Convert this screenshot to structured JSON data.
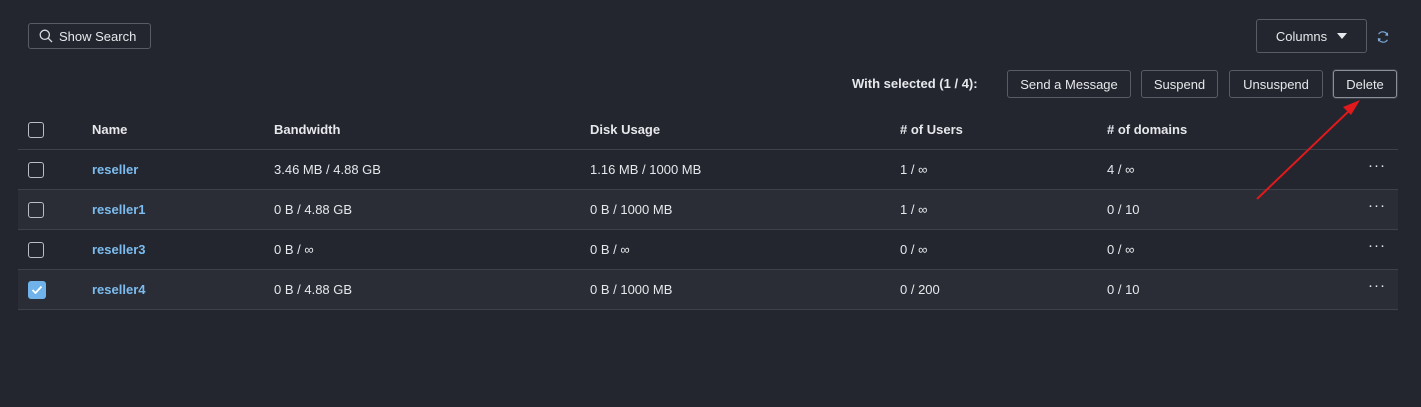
{
  "toolbar": {
    "show_search_label": "Show Search",
    "columns_label": "Columns",
    "with_selected_label": "With selected (1 / 4):",
    "send_message_label": "Send a Message",
    "suspend_label": "Suspend",
    "unsuspend_label": "Unsuspend",
    "delete_label": "Delete"
  },
  "table": {
    "headers": {
      "name": "Name",
      "bandwidth": "Bandwidth",
      "disk_usage": "Disk Usage",
      "users": "# of Users",
      "domains": "# of domains"
    },
    "rows": [
      {
        "name": "reseller",
        "bandwidth": "3.46 MB / 4.88 GB",
        "disk": "1.16 MB / 1000 MB",
        "users": "1 / ∞",
        "domains": "4 / ∞",
        "checked": false
      },
      {
        "name": "reseller1",
        "bandwidth": "0 B / 4.88 GB",
        "disk": "0 B / 1000 MB",
        "users": "1 / ∞",
        "domains": "0 / 10",
        "checked": false
      },
      {
        "name": "reseller3",
        "bandwidth": "0 B / ∞",
        "disk": "0 B / ∞",
        "users": "0 / ∞",
        "domains": "0 / ∞",
        "checked": false
      },
      {
        "name": "reseller4",
        "bandwidth": "0 B / 4.88 GB",
        "disk": "0 B / 1000 MB",
        "users": "0 / 200",
        "domains": "0 / 10",
        "checked": true
      }
    ],
    "row_menu_glyph": "···"
  },
  "colors": {
    "background": "#23262e",
    "link": "#7cbcf0",
    "checked": "#6fb3ea",
    "annotation_arrow": "#e0191c"
  },
  "icons": {
    "search": "search-icon",
    "caret": "caret-down-icon",
    "refresh": "refresh-icon",
    "check": "checkmark-icon",
    "menu": "more-horizontal-icon"
  }
}
